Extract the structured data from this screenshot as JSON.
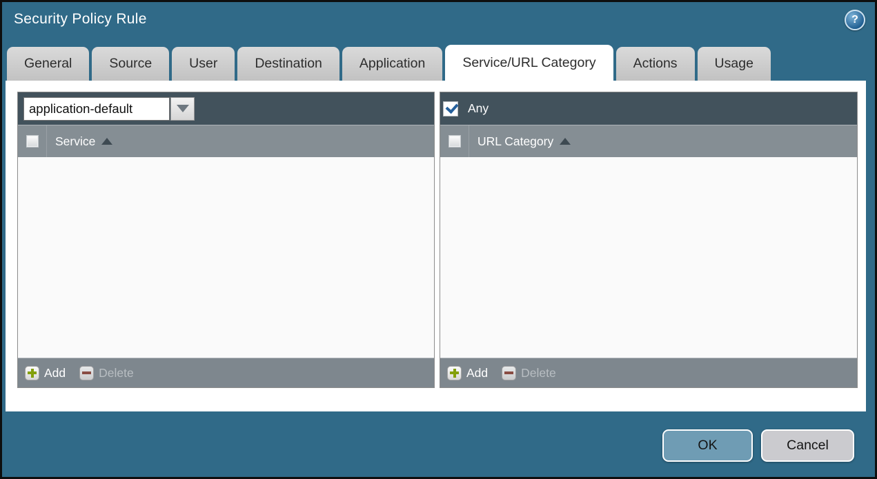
{
  "window": {
    "title": "Security Policy Rule"
  },
  "icons": {
    "help_glyph": "?",
    "dropdown_arrow": "triangle-down",
    "sort_ascending": "triangle-up",
    "add": "green-plus",
    "delete": "red-minus",
    "checked": "blue-check"
  },
  "tabs": [
    {
      "label": "General",
      "active": false
    },
    {
      "label": "Source",
      "active": false
    },
    {
      "label": "User",
      "active": false
    },
    {
      "label": "Destination",
      "active": false
    },
    {
      "label": "Application",
      "active": false
    },
    {
      "label": "Service/URL Category",
      "active": true
    },
    {
      "label": "Actions",
      "active": false
    },
    {
      "label": "Usage",
      "active": false
    }
  ],
  "service_panel": {
    "dropdown_value": "application-default",
    "column_header": "Service",
    "header_checkbox_checked": false,
    "rows": [],
    "add_label": "Add",
    "delete_label": "Delete",
    "delete_enabled": false
  },
  "url_panel": {
    "any_label": "Any",
    "any_checked": true,
    "column_header": "URL Category",
    "header_checkbox_checked": false,
    "rows": [],
    "add_label": "Add",
    "delete_label": "Delete",
    "delete_enabled": false
  },
  "footer": {
    "ok_label": "OK",
    "cancel_label": "Cancel"
  },
  "colors": {
    "window_background": "#306A88",
    "window_border": "#0e0e0e",
    "tab_inactive": "#c9c9c9",
    "tab_active": "#ffffff",
    "panel_toolbar": "#42525C",
    "panel_header": "#858E94",
    "panel_body": "#FAFAFA",
    "panel_footer": "#7E878E",
    "add_plus": "#84A00C",
    "delete_minus": "#8C4237",
    "check_blue": "#25609c",
    "ok_button": "#6F9CB4",
    "cancel_button": "#CBCBCF"
  }
}
